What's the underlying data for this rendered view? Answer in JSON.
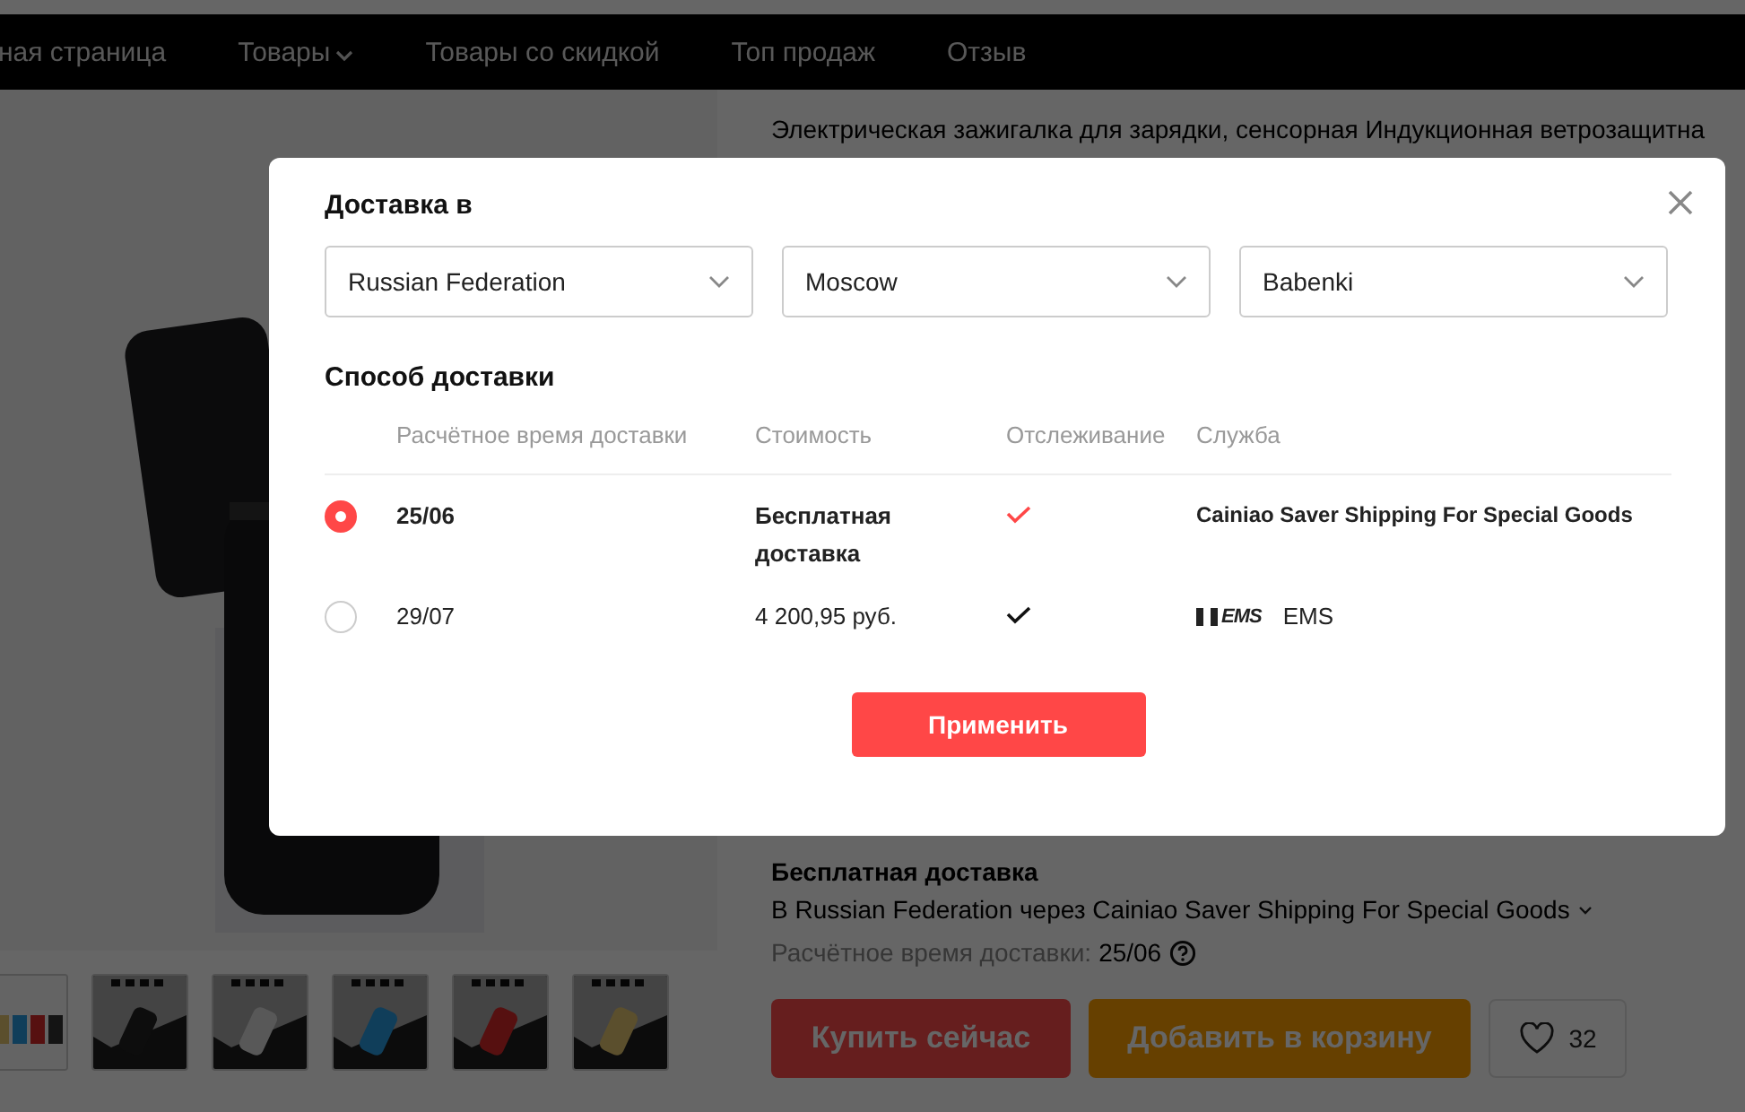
{
  "nav": {
    "items": [
      {
        "label": "ная страница",
        "has_menu": false
      },
      {
        "label": "Товары",
        "has_menu": true
      },
      {
        "label": "Товары со скидкой",
        "has_menu": false
      },
      {
        "label": "Топ продаж",
        "has_menu": false
      },
      {
        "label": "Отзыв",
        "has_menu": false
      }
    ]
  },
  "product": {
    "title": "Электрическая зажигалка для зарядки, сенсорная Индукционная ветрозащитна",
    "shipping": {
      "heading": "Бесплатная доставка",
      "route": "В Russian Federation через Cainiao Saver Shipping For Special Goods",
      "eta_label": "Расчётное время доставки:",
      "eta": "25/06"
    },
    "actions": {
      "buy": "Купить сейчас",
      "cart": "Добавить в корзину",
      "likes": "32"
    }
  },
  "modal": {
    "title": "Доставка в",
    "selects": [
      "Russian Federation",
      "Moscow",
      "Babenki"
    ],
    "method_title": "Способ доставки",
    "columns": [
      "Расчётное время доставки",
      "Стоимость",
      "Отслеживание",
      "Служба"
    ],
    "options": [
      {
        "selected": true,
        "date": "25/06",
        "cost": "Бесплатная доставка",
        "tracking": true,
        "service": "Cainiao Saver Shipping For Special Goods"
      },
      {
        "selected": false,
        "date": "29/07",
        "cost": "4 200,95 руб.",
        "tracking": true,
        "logo_text": "EMS",
        "service": "EMS"
      }
    ],
    "apply": "Применить"
  }
}
